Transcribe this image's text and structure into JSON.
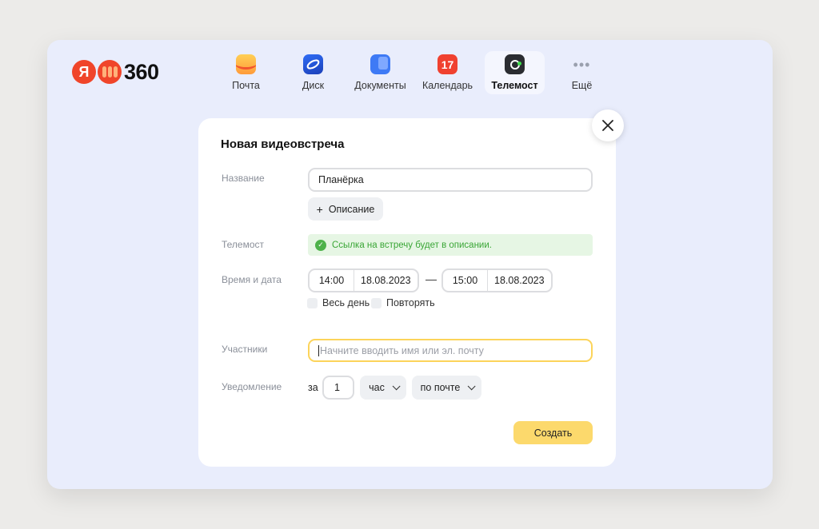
{
  "app": {
    "logo_letter": "Я",
    "logo_number": "360"
  },
  "nav": {
    "items": [
      {
        "label": "Почта",
        "icon": "mail-icon"
      },
      {
        "label": "Диск",
        "icon": "disk-icon"
      },
      {
        "label": "Документы",
        "icon": "docs-icon"
      },
      {
        "label": "Календарь",
        "icon": "calendar-icon",
        "badge": "17"
      },
      {
        "label": "Телемост",
        "icon": "telemost-icon",
        "active": true
      },
      {
        "label": "Ещё",
        "icon": "more-icon"
      }
    ]
  },
  "dialog": {
    "title": "Новая видеовстреча",
    "name_label": "Название",
    "name_value": "Планёрка",
    "description_button": "Описание",
    "telemost_label": "Телемост",
    "telemost_notice": "Ссылка на встречу будет в описании.",
    "datetime_label": "Время и дата",
    "start_time": "14:00",
    "start_date": "18.08.2023",
    "end_time": "15:00",
    "end_date": "18.08.2023",
    "all_day_label": "Весь день",
    "repeat_label": "Повторять",
    "participants_label": "Участники",
    "participants_placeholder": "Начните вводить имя или эл. почту",
    "notification_label": "Уведомление",
    "notify_prefix": "за",
    "notify_amount": "1",
    "notify_unit": "час",
    "notify_channel": "по почте",
    "create_button": "Создать"
  },
  "colors": {
    "window_bg": "#e9edfc",
    "accent_yellow": "#fcd96c",
    "notice_green": "#3aa636",
    "brand_red": "#f0452a"
  }
}
